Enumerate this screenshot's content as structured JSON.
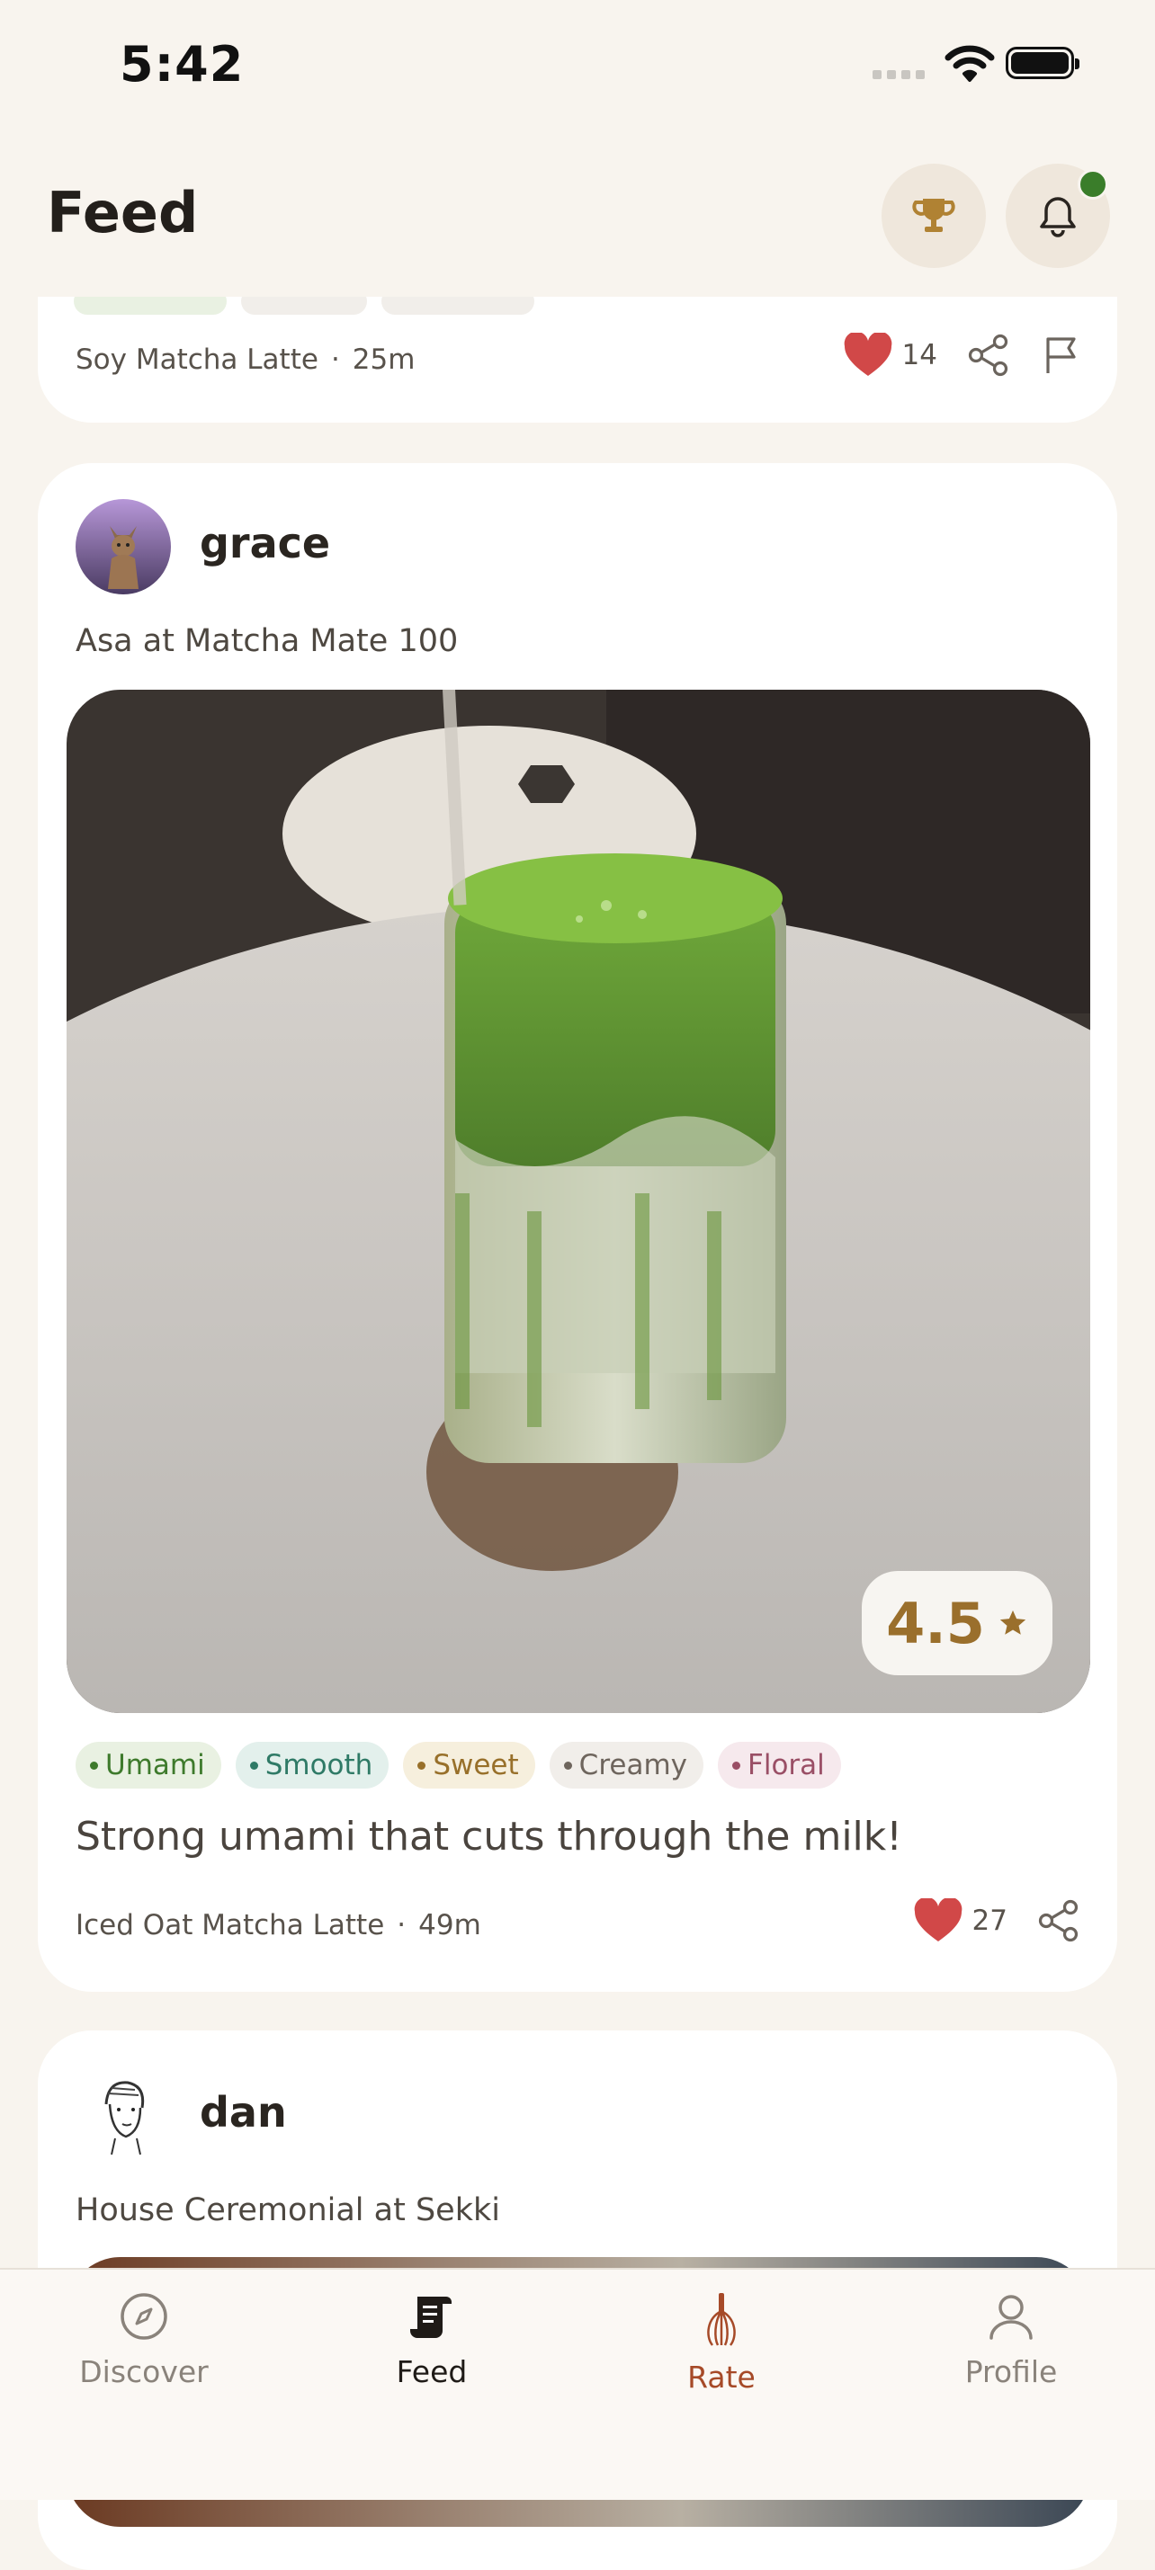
{
  "status_bar": {
    "time": "5:42"
  },
  "header": {
    "title": "Feed",
    "trophy_icon": "trophy-icon",
    "bell_icon": "bell-icon"
  },
  "posts": [
    {
      "drink": "Soy Matcha Latte",
      "age": "25m",
      "likes": "14"
    },
    {
      "user": "grace",
      "subtitle": "Asa at Matcha Mate 100",
      "rating": "4.5",
      "tags": [
        "Umami",
        "Smooth",
        "Sweet",
        "Creamy",
        "Floral"
      ],
      "review": "Strong umami that cuts through the milk!",
      "drink": "Iced Oat Matcha Latte",
      "age": "49m",
      "likes": "27"
    },
    {
      "user": "dan",
      "subtitle": "House Ceremonial at Sekki"
    }
  ],
  "tabbar": {
    "items": [
      {
        "label": "Discover",
        "icon": "compass-icon"
      },
      {
        "label": "Feed",
        "icon": "scroll-icon"
      },
      {
        "label": "Rate",
        "icon": "whisk-icon"
      },
      {
        "label": "Profile",
        "icon": "person-icon"
      }
    ]
  },
  "colors": {
    "background": "#f8f4ee",
    "heart": "#d14848",
    "accent_gold": "#9a6f2c",
    "rate_accent": "#a64a28",
    "notification": "#3a7d2a"
  }
}
